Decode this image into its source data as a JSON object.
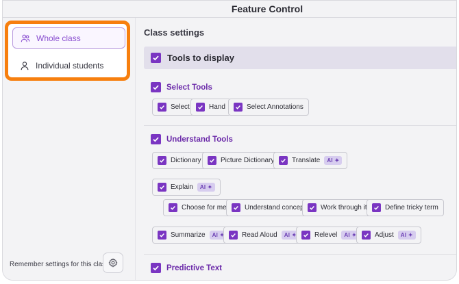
{
  "window": {
    "title": "Feature Control"
  },
  "sidebar": {
    "items": [
      {
        "label": "Whole class",
        "icon": "users-icon",
        "active": true
      },
      {
        "label": "Individual students",
        "icon": "user-icon",
        "active": false
      }
    ],
    "remember_label": "Remember settings for this class",
    "settings_icon": "gear-icon"
  },
  "main": {
    "title": "Class settings",
    "banner": "Tools to display",
    "ai_badge": "AI",
    "sections": {
      "select": {
        "title": "Select Tools",
        "items": [
          "Select",
          "Hand",
          "Select Annotations"
        ]
      },
      "understand": {
        "title": "Understand Tools",
        "items": [
          "Dictionary",
          "Picture Dictionary",
          "Translate",
          "Explain"
        ],
        "explain_sub": [
          "Choose for me",
          "Understand concept",
          "Work through it",
          "Define tricky term"
        ],
        "row3": [
          "Summarize",
          "Read Aloud",
          "Relevel",
          "Adjust"
        ]
      },
      "predictive": {
        "title": "Predictive Text"
      }
    }
  },
  "colors": {
    "accent": "#7a35c2",
    "highlight_border": "#f77f0e",
    "banner_bg": "#e2dfeb",
    "ai_badge_bg": "#d7cdef"
  }
}
